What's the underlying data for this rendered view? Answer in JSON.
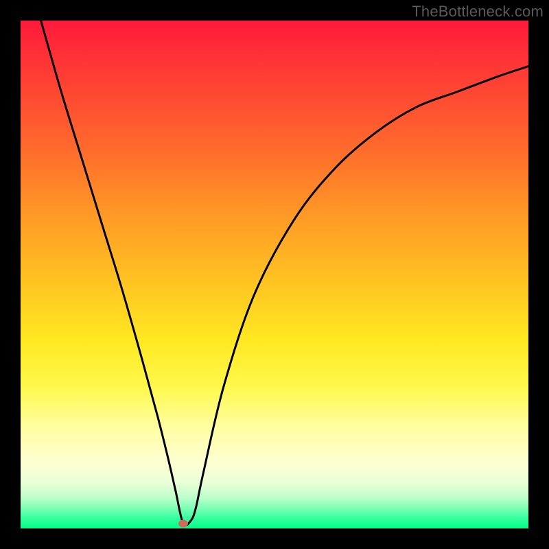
{
  "watermark": "TheBottleneck.com",
  "chart_data": {
    "type": "line",
    "title": "",
    "xlabel": "",
    "ylabel": "",
    "xlim": [
      0,
      100
    ],
    "ylim": [
      0,
      100
    ],
    "grid": false,
    "legend": false,
    "background_gradient": {
      "top_color": "#ff1a3a",
      "bottom_color": "#00ff88"
    },
    "series": [
      {
        "name": "bottleneck-curve",
        "color": "#000000",
        "x": [
          4,
          8,
          12,
          16,
          20,
          24,
          27,
          29,
          30.5,
          32,
          33.5,
          34.5,
          36,
          40,
          46,
          54,
          62,
          70,
          78,
          86,
          94,
          100
        ],
        "values": [
          100,
          86,
          73,
          60,
          47,
          33,
          22,
          14,
          7.5,
          1,
          1.5,
          4,
          11,
          28,
          46,
          61,
          71,
          78,
          83,
          86,
          89,
          91
        ]
      }
    ],
    "min_point": {
      "x": 32,
      "y": 1,
      "color": "#d06a5a"
    }
  }
}
